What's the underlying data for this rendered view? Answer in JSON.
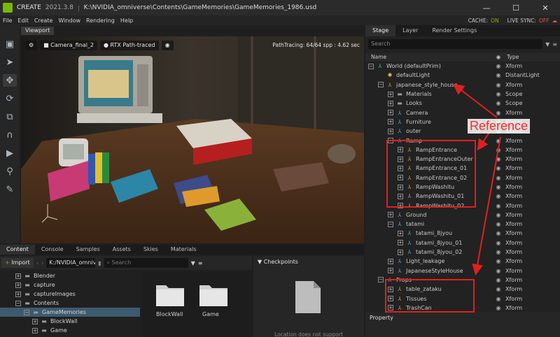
{
  "titlebar": {
    "app_name": "CREATE",
    "version": "2021.3.8",
    "separator": "|",
    "path": "K:\\NVIDIA_omniverse\\Contents\\GameMemories\\GameMemories_1986.usd",
    "min": "—",
    "max": "☐",
    "close": "✕"
  },
  "menu": {
    "items": [
      "File",
      "Edit",
      "Create",
      "Window",
      "Rendering",
      "Help"
    ],
    "cache_label": "CACHE:",
    "cache_value": "ON",
    "live_label": "LIVE SYNC:",
    "live_value": "OFF"
  },
  "viewport": {
    "tab": "Viewport",
    "camera": "Camera_final_2",
    "render_mode": "RTX Path-traced",
    "stats": "PathTracing: 64/64 spp : 4.62 sec"
  },
  "stage": {
    "tabs": [
      "Stage",
      "Layer",
      "Render Settings"
    ],
    "search_placeholder": "Search",
    "col_name": "Name",
    "col_type": "Type",
    "rows": [
      {
        "name": "World (defaultPrim)",
        "type": "Xform",
        "exp": "−"
      },
      {
        "name": "defaultLight",
        "type": "DistantLight",
        "exp": ""
      },
      {
        "name": "japanese_style_house",
        "type": "Xform",
        "exp": "−"
      },
      {
        "name": "Materials",
        "type": "Scope",
        "exp": "+"
      },
      {
        "name": "Looks",
        "type": "Scope",
        "exp": "+"
      },
      {
        "name": "Camera",
        "type": "Xform",
        "exp": "+"
      },
      {
        "name": "Furniture",
        "type": "Xform",
        "exp": "+"
      },
      {
        "name": "outer",
        "type": "Xform",
        "exp": "+"
      },
      {
        "name": "Ramp",
        "type": "Xform",
        "exp": "−"
      },
      {
        "name": "RampEntrance",
        "type": "Xform",
        "exp": "+"
      },
      {
        "name": "RampEntranceOuter",
        "type": "Xform",
        "exp": "+"
      },
      {
        "name": "RampEntrance_01",
        "type": "Xform",
        "exp": "+"
      },
      {
        "name": "RampEntrance_02",
        "type": "Xform",
        "exp": "+"
      },
      {
        "name": "RampWashitu",
        "type": "Xform",
        "exp": "+"
      },
      {
        "name": "RampWashitu_01",
        "type": "Xform",
        "exp": "+"
      },
      {
        "name": "RampWashitu_02",
        "type": "Xform",
        "exp": "+"
      },
      {
        "name": "Ground",
        "type": "Xform",
        "exp": "+"
      },
      {
        "name": "tatami",
        "type": "Xform",
        "exp": "−"
      },
      {
        "name": "tatami_8jyou",
        "type": "Xform",
        "exp": "+"
      },
      {
        "name": "tatami_8jyou_01",
        "type": "Xform",
        "exp": "+"
      },
      {
        "name": "tatami_8jyou_02",
        "type": "Xform",
        "exp": "+"
      },
      {
        "name": "Light_leakage",
        "type": "Xform",
        "exp": "+"
      },
      {
        "name": "JapaneseStyleHouse",
        "type": "Xform",
        "exp": "+"
      },
      {
        "name": "Props",
        "type": "Xform",
        "exp": "−"
      },
      {
        "name": "table_zataku",
        "type": "Xform",
        "exp": "+"
      },
      {
        "name": "Tissues",
        "type": "Xform",
        "exp": "+"
      },
      {
        "name": "TrashCan",
        "type": "Xform",
        "exp": "+"
      }
    ]
  },
  "property": {
    "title": "Property"
  },
  "bottom": {
    "tabs": [
      "Content",
      "Console",
      "Samples",
      "Assets",
      "Skies",
      "Materials"
    ],
    "import_label": "Import",
    "path": "K:/NVIDIA_omniv",
    "search_placeholder": "Search",
    "tree": [
      {
        "name": "Blender",
        "exp": "+"
      },
      {
        "name": "capture",
        "exp": "+"
      },
      {
        "name": "captureImages",
        "exp": "+"
      },
      {
        "name": "Contents",
        "exp": "−"
      },
      {
        "name": "GameMemories",
        "exp": "−"
      },
      {
        "name": "BlockWall",
        "exp": "+"
      },
      {
        "name": "Game",
        "exp": "+"
      }
    ],
    "thumbs": [
      "BlockWall",
      "Game"
    ],
    "checkpoints_title": "Checkpoints",
    "checkpoints_msg": "Location does not support"
  },
  "annotation": {
    "label": "Reference"
  }
}
